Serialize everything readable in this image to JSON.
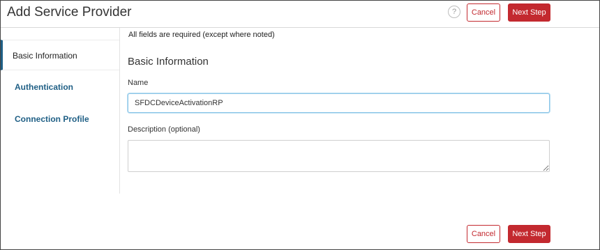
{
  "header": {
    "title": "Add Service Provider",
    "help_icon": "?",
    "cancel_label": "Cancel",
    "next_label": "Next Step"
  },
  "sidebar": {
    "items": [
      {
        "label": "Basic Information",
        "active": true
      },
      {
        "label": "Authentication",
        "active": false
      },
      {
        "label": "Connection Profile",
        "active": false
      }
    ]
  },
  "form": {
    "required_note": "All fields are required (except where noted)",
    "section_title": "Basic Information",
    "name_label": "Name",
    "name_value": "SFDCDeviceActivationRP",
    "description_label": "Description (optional)",
    "description_value": ""
  },
  "footer": {
    "cancel_label": "Cancel",
    "next_label": "Next Step"
  },
  "colors": {
    "accent": "#c3292f",
    "link": "#1f5f85",
    "focus_border": "#8dc6e8"
  }
}
